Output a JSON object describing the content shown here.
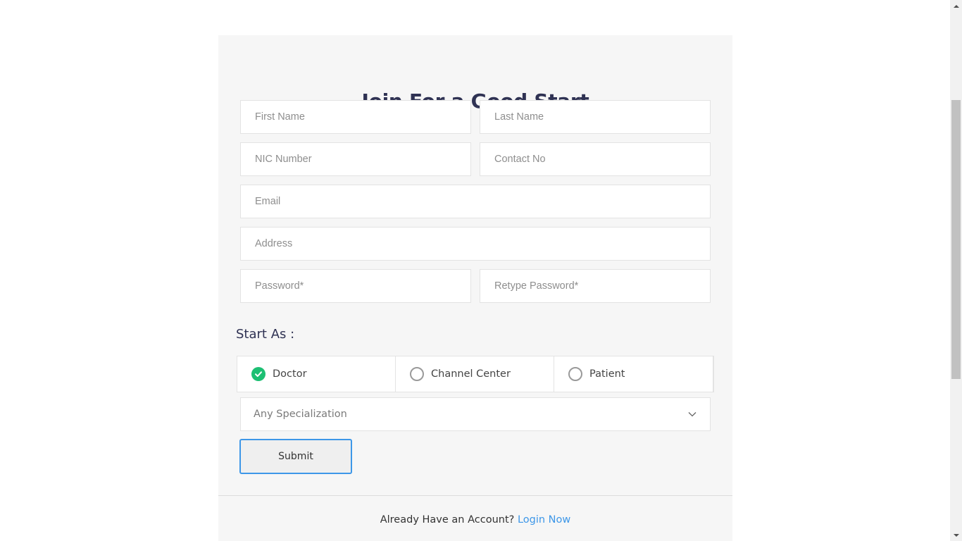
{
  "form": {
    "title": "Join For a Good Start",
    "fields": {
      "first_name": "First Name",
      "last_name": "Last Name",
      "nic": "NIC Number",
      "contact": "Contact No",
      "email": "Email",
      "address": "Address",
      "password": "Password*",
      "retype_password": "Retype Password*"
    },
    "start_as_label": "Start As :",
    "roles": [
      {
        "label": "Doctor",
        "selected": true
      },
      {
        "label": "Channel Center",
        "selected": false
      },
      {
        "label": "Patient",
        "selected": false
      }
    ],
    "specialization": {
      "selected": "Any Specialization",
      "icon": "chevron-down-icon"
    },
    "submit_label": "Submit"
  },
  "footer": {
    "prompt": "Already Have an Account?",
    "link": "Login Now"
  },
  "colors": {
    "accent": "#3d97e8",
    "selected": "#1dbf73",
    "title": "#2f3253"
  }
}
